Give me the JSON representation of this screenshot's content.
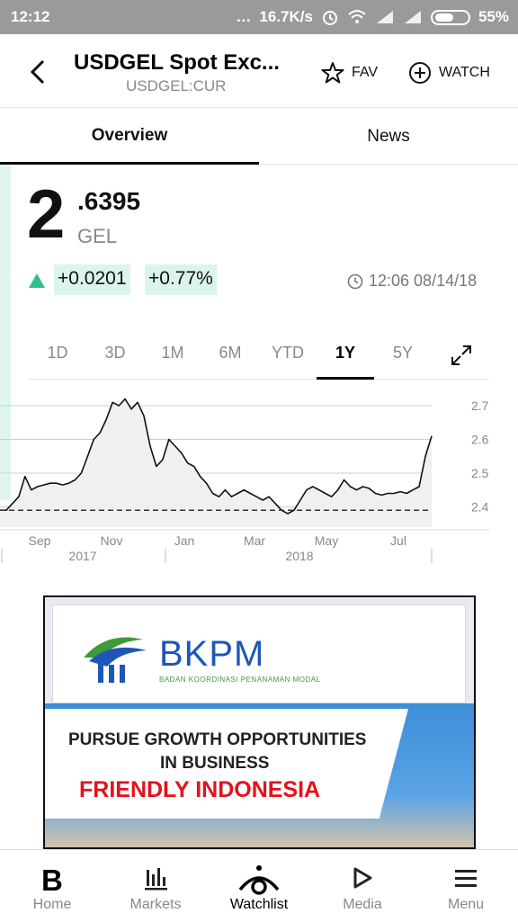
{
  "status_bar": {
    "time": "12:12",
    "network_speed": "16.7K/s",
    "battery": "55%"
  },
  "header": {
    "title": "USDGEL Spot Exc...",
    "ticker": "USDGEL:CUR",
    "fav_label": "FAV",
    "watch_label": "WATCH"
  },
  "tabs": [
    {
      "label": "Overview",
      "selected": true
    },
    {
      "label": "News",
      "selected": false
    }
  ],
  "quote": {
    "price_integer": "2",
    "price_decimals": ".6395",
    "currency": "GEL",
    "change": "+0.0201",
    "change_percent": "+0.77%",
    "timestamp": "12:06 08/14/18",
    "direction_color": "#2fbf8a"
  },
  "range_buttons": [
    "1D",
    "3D",
    "1M",
    "6M",
    "YTD",
    "1Y",
    "5Y"
  ],
  "selected_range": "1Y",
  "chart_data": {
    "type": "area",
    "series": [
      {
        "values": [
          2.39,
          2.39,
          2.41,
          2.43,
          2.49,
          2.45,
          2.46,
          2.465,
          2.47,
          2.47,
          2.465,
          2.47,
          2.48,
          2.5,
          2.55,
          2.6,
          2.62,
          2.66,
          2.71,
          2.7,
          2.72,
          2.69,
          2.71,
          2.67,
          2.58,
          2.52,
          2.54,
          2.6,
          2.58,
          2.56,
          2.53,
          2.52,
          2.49,
          2.47,
          2.44,
          2.43,
          2.45,
          2.43,
          2.44,
          2.45,
          2.44,
          2.43,
          2.42,
          2.43,
          2.41,
          2.39,
          2.38,
          2.39,
          2.42,
          2.45,
          2.46,
          2.45,
          2.44,
          2.43,
          2.45,
          2.48,
          2.46,
          2.45,
          2.46,
          2.455,
          2.44,
          2.435,
          2.44,
          2.44,
          2.445,
          2.44,
          2.45,
          2.46,
          2.55,
          2.61
        ]
      }
    ],
    "y_ticks": [
      2.7,
      2.6,
      2.5,
      2.4
    ],
    "ylim": [
      2.34,
      2.74
    ],
    "x_tick_labels": [
      "Sep",
      "Nov",
      "Jan",
      "Mar",
      "May",
      "Jul"
    ],
    "year_labels": [
      "2017",
      "2018"
    ],
    "reference_line": 2.39,
    "grid": true
  },
  "ad": {
    "brand": "BKPM",
    "brand_subtitle": "BADAN KOORDINASI PENANAMAN MODAL",
    "line1": "PURSUE GROWTH OPPORTUNITIES",
    "line2": "IN BUSINESS",
    "line3": "FRIENDLY INDONESIA"
  },
  "bottom_nav": [
    {
      "label": "Home",
      "icon": "bloomberg-b-icon"
    },
    {
      "label": "Markets",
      "icon": "bar-chart-icon"
    },
    {
      "label": "Watchlist",
      "icon": "eye-icon",
      "active": true
    },
    {
      "label": "Media",
      "icon": "play-icon"
    },
    {
      "label": "Menu",
      "icon": "menu-icon"
    }
  ]
}
